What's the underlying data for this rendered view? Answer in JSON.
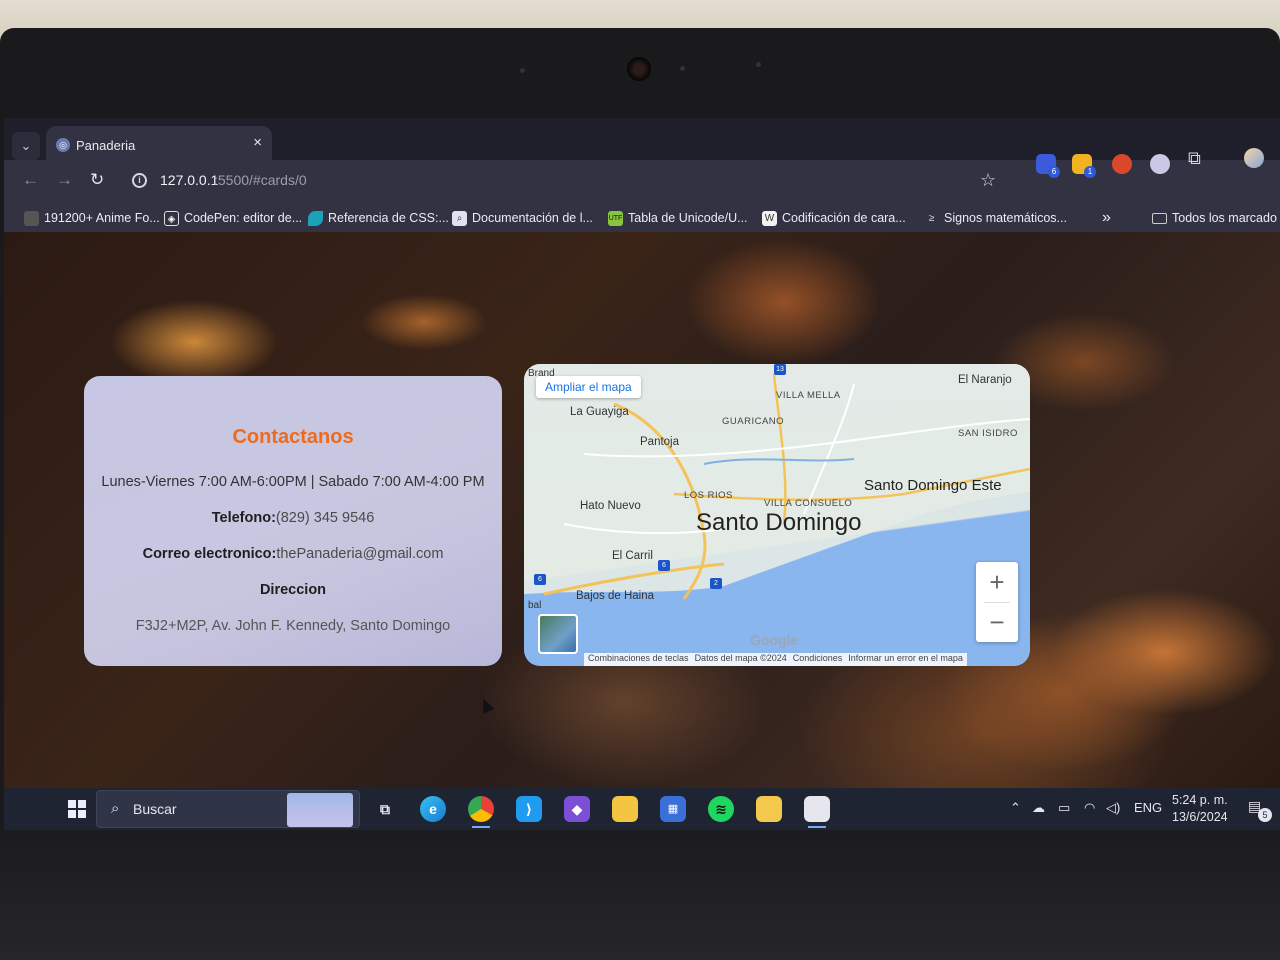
{
  "browser": {
    "tab": {
      "title": "Panaderia",
      "close_symbol": "×"
    },
    "address": {
      "host": "127.0.0.1",
      "path": ":5500/#cards/0"
    },
    "extension_badges": [
      "6",
      "1"
    ],
    "bookmarks": [
      {
        "label": "191200+ Anime Fo...",
        "icon": "image-icon"
      },
      {
        "label": "CodePen: editor de...",
        "icon": "codepen-icon"
      },
      {
        "label": "Referencia de CSS:...",
        "icon": "mdn-icon"
      },
      {
        "label": "Documentación de l...",
        "icon": "search-doc-icon"
      },
      {
        "label": "Tabla de Unicode/U...",
        "icon": "utf8-icon"
      },
      {
        "label": "Codificación de cara...",
        "icon": "w-icon"
      },
      {
        "label": "Signos matemáticos...",
        "icon": "math-icon"
      }
    ],
    "more_bookmarks": "»",
    "all_bookmarks": "Todos los marcado"
  },
  "contact": {
    "title": "Contactanos",
    "hours": "Lunes-Viernes 7:00 AM-6:00PM | Sabado 7:00 AM-4:00 PM",
    "phone_label": "Telefono:",
    "phone_value": "(829) 345 9546",
    "email_label": "Correo electronico:",
    "email_value": "thePanaderia@gmail.com",
    "address_label": "Direccion",
    "address_value": "F3J2+M2P, Av. John F. Kennedy, Santo Domingo"
  },
  "map": {
    "enlarge_link": "Ampliar el mapa",
    "labels": {
      "el_naranjo": "El Naranjo",
      "villa_mella": "VILLA MELLA",
      "la_guayiga": "La Guayiga",
      "guaricano": "GUARICANO",
      "san_isidro": "SAN ISIDRO",
      "pantoja": "Pantoja",
      "los_rios": "LOS RIOS",
      "villa_consuelo": "VILLA CONSUELO",
      "santo_domingo_este": "Santo Domingo Este",
      "hato_nuevo": "Hato Nuevo",
      "santo_domingo": "Santo Domingo",
      "el_carril": "El Carril",
      "bajos_de_haina": "Bajos de Haina",
      "bal": "bal",
      "brand": "Brand"
    },
    "shields": [
      "13",
      "6",
      "2",
      "6"
    ],
    "zoom_in": "+",
    "zoom_out": "−",
    "google": "Google",
    "footer": [
      "Combinaciones de teclas",
      "Datos del mapa ©2024",
      "Condiciones",
      "Informar un error en el mapa"
    ]
  },
  "taskbar": {
    "search_placeholder": "Buscar",
    "language": "ENG",
    "time": "5:24 p. m.",
    "date": "13/6/2024",
    "notification_count": "5"
  }
}
